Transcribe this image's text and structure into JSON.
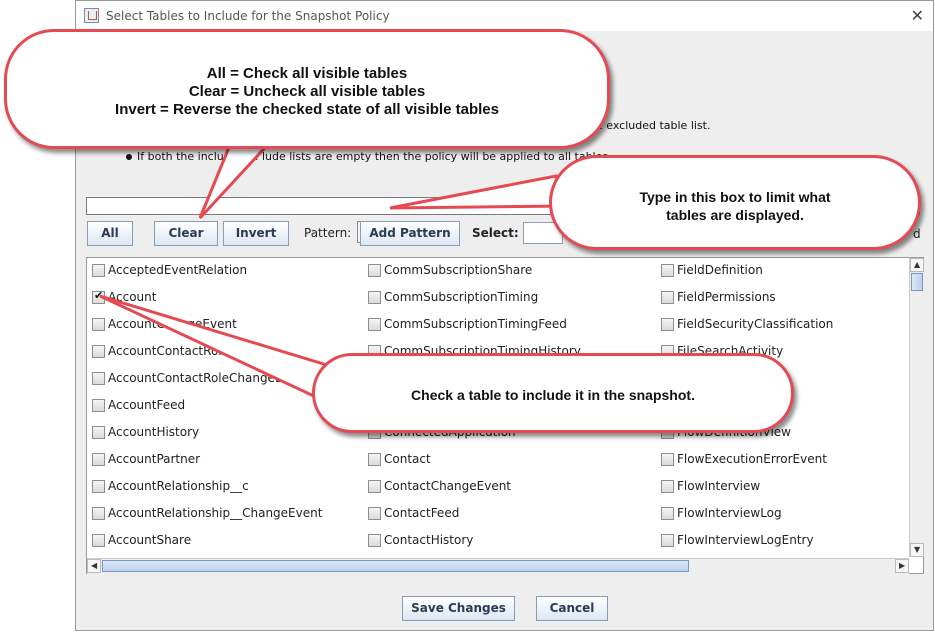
{
  "window": {
    "title": "Select Tables to Include for the Snapshot Policy",
    "close": "✕"
  },
  "instructions": {
    "excluded_fragment": "e excluded table list.",
    "bullet": "If both the included ... lude lists are empty then the policy will be applied to all tables."
  },
  "toolbar": {
    "all_label": "All",
    "clear_label": "Clear",
    "invert_label": "Invert",
    "pattern_label": "Pattern:",
    "add_pattern_label": "Add Pattern",
    "select_label": "Select:",
    "d_fragment": "d"
  },
  "filter": {
    "value": ""
  },
  "tables": {
    "col1": [
      {
        "name": "AcceptedEventRelation",
        "checked": false
      },
      {
        "name": "Account",
        "checked": true
      },
      {
        "name": "AccountChangeEvent",
        "checked": false
      },
      {
        "name": "AccountContactRole",
        "checked": false
      },
      {
        "name": "AccountContactRoleChangeEvent",
        "checked": false
      },
      {
        "name": "AccountFeed",
        "checked": false
      },
      {
        "name": "AccountHistory",
        "checked": false
      },
      {
        "name": "AccountPartner",
        "checked": false
      },
      {
        "name": "AccountRelationship__c",
        "checked": false
      },
      {
        "name": "AccountRelationship__ChangeEvent",
        "checked": false
      },
      {
        "name": "AccountShare",
        "checked": false
      }
    ],
    "col2": [
      {
        "name": "CommSubscriptionShare",
        "checked": false
      },
      {
        "name": "CommSubscriptionTiming",
        "checked": false
      },
      {
        "name": "CommSubscriptionTimingFeed",
        "checked": false
      },
      {
        "name": "CommSubscriptionTimingHistory",
        "checked": false
      },
      {
        "name": "",
        "checked": false
      },
      {
        "name": "",
        "checked": false
      },
      {
        "name": "ConnectedApplication",
        "checked": false
      },
      {
        "name": "Contact",
        "checked": false
      },
      {
        "name": "ContactChangeEvent",
        "checked": false
      },
      {
        "name": "ContactFeed",
        "checked": false
      },
      {
        "name": "ContactHistory",
        "checked": false
      }
    ],
    "col3": [
      {
        "name": "FieldDefinition",
        "checked": false
      },
      {
        "name": "FieldPermissions",
        "checked": false
      },
      {
        "name": "FieldSecurityClassification",
        "checked": false
      },
      {
        "name": "FileSearchActivity",
        "checked": false
      },
      {
        "name": "",
        "checked": false
      },
      {
        "name": "",
        "checked": false
      },
      {
        "name": "FlowDefinitionView",
        "checked": false
      },
      {
        "name": "FlowExecutionErrorEvent",
        "checked": false
      },
      {
        "name": "FlowInterview",
        "checked": false
      },
      {
        "name": "FlowInterviewLog",
        "checked": false
      },
      {
        "name": "FlowInterviewLogEntry",
        "checked": false
      }
    ]
  },
  "footer": {
    "save_label": "Save Changes",
    "cancel_label": "Cancel"
  },
  "callouts": {
    "buttons_line1": "All = Check all visible tables",
    "buttons_line2": "Clear = Uncheck all visible tables",
    "buttons_line3": "Invert = Reverse the checked state of all visible tables",
    "filter_line1": "Type in this box to limit what",
    "filter_line2": "tables are displayed.",
    "check_text": "Check a table to include it in the snapshot."
  },
  "colors": {
    "callout_border": "#e54a52",
    "button_text": "#2b3a55"
  }
}
